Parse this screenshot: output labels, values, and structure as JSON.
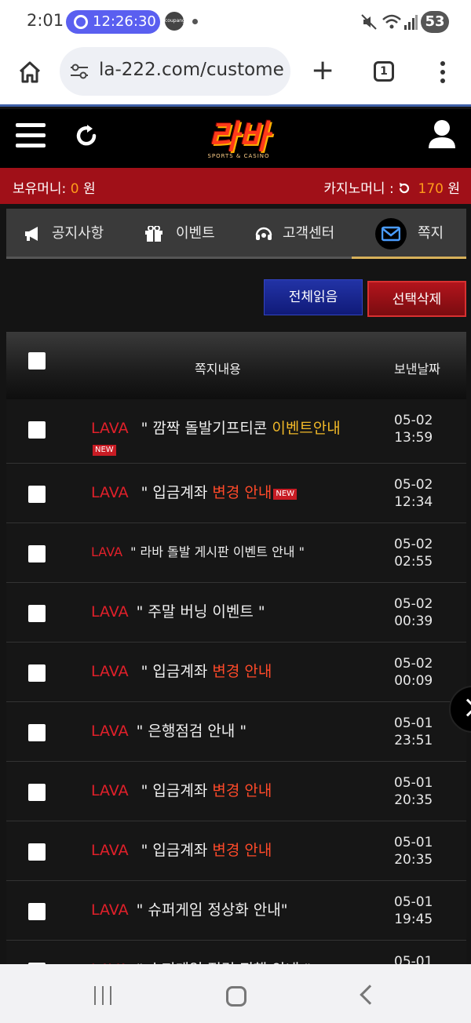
{
  "status_bar": {
    "time": "2:01",
    "timer": "12:26:30",
    "eats_label": "coupang eats",
    "battery": "53"
  },
  "browser": {
    "url": "la-222.com/custome",
    "tab_count": "1"
  },
  "header": {
    "logo_text": "라바",
    "logo_sub": "SPORTS & CASINO"
  },
  "money": {
    "holding_label": "보유머니:",
    "holding_value": "0",
    "holding_unit": "원",
    "casino_label": "카지노머니 :",
    "casino_value": "170",
    "casino_unit": "원"
  },
  "tabs": [
    {
      "label": "공지사항",
      "icon": "megaphone-icon"
    },
    {
      "label": "이벤트",
      "icon": "gift-icon"
    },
    {
      "label": "고객센터",
      "icon": "headset-icon"
    },
    {
      "label": "쪽지",
      "icon": "envelope-icon",
      "active": true
    }
  ],
  "actions": {
    "read_all": "전체읽음",
    "delete_selected": "선택삭제"
  },
  "table": {
    "col_content": "쪽지내용",
    "col_date": "보낸날짜",
    "rows": [
      {
        "sender": "LAVA",
        "pre": " \" 깜짝 돌발기프티콘 ",
        "hl": "이벤트안내",
        "post": "",
        "new": true,
        "date": "05-02",
        "time": "13:59"
      },
      {
        "sender": "LAVA",
        "pre": " \" 입금계좌 ",
        "hl": "변경 안내",
        "post": "",
        "new": true,
        "date": "05-02",
        "time": "12:34"
      },
      {
        "sender": "LAVA",
        "pre": "\"  라바  돌발 게시판 이벤트 안내 \"",
        "hl": "",
        "post": "",
        "new": false,
        "date": "05-02",
        "time": "02:55"
      },
      {
        "sender": "LAVA",
        "pre": "\" 주말 버닝 이벤트 \"",
        "hl": "",
        "post": "",
        "new": false,
        "date": "05-02",
        "time": "00:39"
      },
      {
        "sender": "LAVA",
        "pre": " \" 입금계좌 ",
        "hl": "변경 안내",
        "post": "",
        "new": false,
        "date": "05-02",
        "time": "00:09"
      },
      {
        "sender": "LAVA",
        "pre": "\" 은행점검 안내 \"",
        "hl": "",
        "post": "",
        "new": false,
        "date": "05-01",
        "time": "23:51"
      },
      {
        "sender": "LAVA",
        "pre": " \" 입금계좌 ",
        "hl": "변경 안내",
        "post": "",
        "new": false,
        "date": "05-01",
        "time": "20:35"
      },
      {
        "sender": "LAVA",
        "pre": " \" 입금계좌 ",
        "hl": "변경 안내",
        "post": "",
        "new": false,
        "date": "05-01",
        "time": "20:35"
      },
      {
        "sender": "LAVA",
        "pre": "\" 슈퍼게임 정상화 안내\"",
        "hl": "",
        "post": "",
        "new": false,
        "date": "05-01",
        "time": "19:45"
      },
      {
        "sender": "LAVA",
        "pre": "\" 슈퍼게임 점검 진행 안내 \"",
        "hl": "",
        "post": "",
        "new": false,
        "date": "05-01",
        "time": ""
      }
    ],
    "new_badge": "NEW"
  }
}
